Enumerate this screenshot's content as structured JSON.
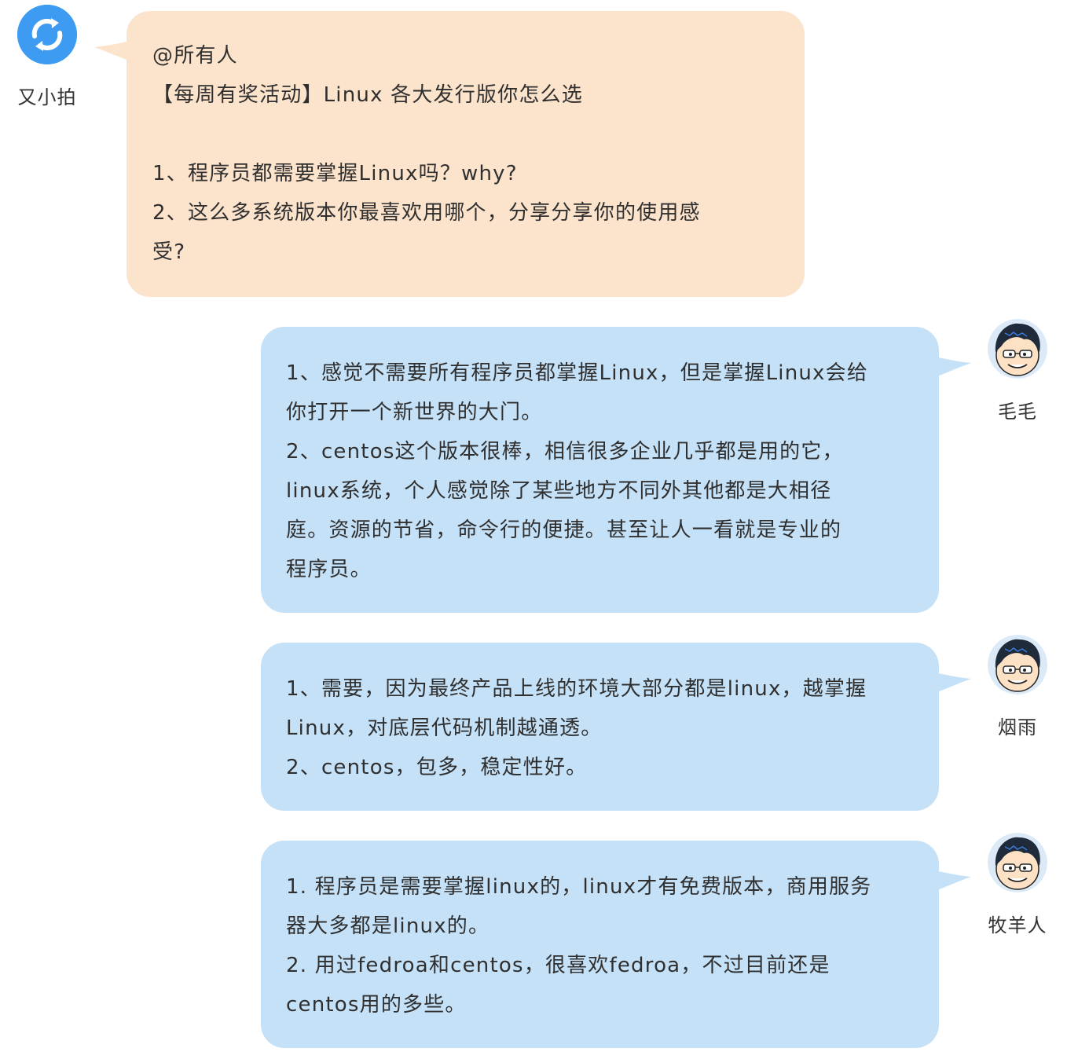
{
  "messages": [
    {
      "sender": "又小拍",
      "avatar_icon": "sync-logo-icon",
      "bubble_color": "#fce3cb",
      "lines": [
        "@所有人",
        "【每周有奖活动】Linux 各大发行版你怎么选",
        "",
        "1、程序员都需要掌握Linux吗？why?",
        "2、这么多系统版本你最喜欢用哪个，分享分享你的使用感",
        "受?"
      ]
    },
    {
      "sender": "毛毛",
      "avatar_icon": "cartoon-boy-avatar-icon",
      "bubble_color": "#c5e1f7",
      "lines": [
        "1、感觉不需要所有程序员都掌握Linux，但是掌握Linux会给",
        "你打开一个新世界的大门。",
        "2、centos这个版本很棒，相信很多企业几乎都是用的它，",
        "linux系统，个人感觉除了某些地方不同外其他都是大相径",
        "庭。资源的节省，命令行的便捷。甚至让人一看就是专业的",
        "程序员。"
      ]
    },
    {
      "sender": "烟雨",
      "avatar_icon": "cartoon-boy-avatar-icon",
      "bubble_color": "#c5e1f7",
      "lines": [
        "1、需要，因为最终产品上线的环境大部分都是linux，越掌握",
        "Linux，对底层代码机制越通透。",
        "2、centos，包多，稳定性好。"
      ]
    },
    {
      "sender": "牧羊人",
      "avatar_icon": "cartoon-boy-avatar-icon",
      "bubble_color": "#c5e1f7",
      "lines": [
        "1. 程序员是需要掌握linux的，linux才有免费版本，商用服务",
        "器大多都是linux的。",
        "2. 用过fedroa和centos，很喜欢fedroa，不过目前还是",
        "centos用的多些。"
      ]
    }
  ]
}
